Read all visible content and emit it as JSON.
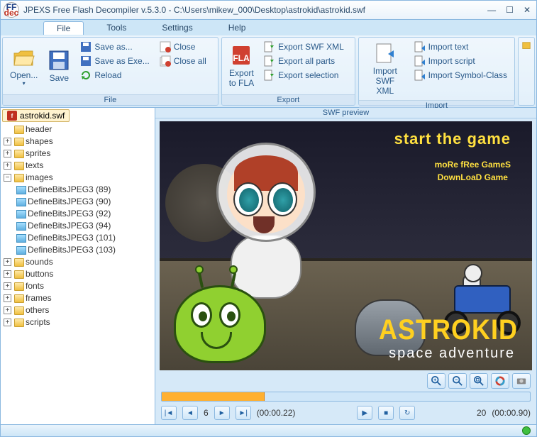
{
  "window": {
    "title": "JPEXS Free Flash Decompiler v.5.3.0 - C:\\Users\\mikew_000\\Desktop\\astrokid\\astrokid.swf",
    "logo_top": "FF",
    "logo_bottom": "dec"
  },
  "menu": {
    "file": "File",
    "tools": "Tools",
    "settings": "Settings",
    "help": "Help"
  },
  "ribbon": {
    "file_group": {
      "label": "File",
      "open": "Open...",
      "save": "Save",
      "save_as": "Save as...",
      "save_as_exe": "Save as Exe...",
      "reload": "Reload",
      "close": "Close",
      "close_all": "Close all"
    },
    "export_group": {
      "label": "Export",
      "export_fla": "Export\nto FLA",
      "export_swf_xml": "Export SWF XML",
      "export_all_parts": "Export all parts",
      "export_selection": "Export selection"
    },
    "import_group": {
      "label": "Import",
      "import_swf_xml": "Import\nSWF XML",
      "import_text": "Import text",
      "import_script": "Import script",
      "import_symbol_class": "Import Symbol-Class"
    }
  },
  "tree": {
    "root": "astrokid.swf",
    "header": "header",
    "shapes": "shapes",
    "sprites": "sprites",
    "texts": "texts",
    "images": "images",
    "images_children": [
      "DefineBitsJPEG3 (89)",
      "DefineBitsJPEG3 (90)",
      "DefineBitsJPEG3 (92)",
      "DefineBitsJPEG3 (94)",
      "DefineBitsJPEG3 (101)",
      "DefineBitsJPEG3 (103)"
    ],
    "sounds": "sounds",
    "buttons": "buttons",
    "fonts": "fonts",
    "frames": "frames",
    "others": "others",
    "scripts": "scripts"
  },
  "preview": {
    "header": "SWF preview",
    "start_game": "StaRt tHe Game",
    "more_games": "moRe fRee GameS",
    "download_game": "DownLoaD Game",
    "title_logo": "ASTROKID",
    "subtitle": "space adventure"
  },
  "playback": {
    "current_frame": "6",
    "current_time": "(00:00.22)",
    "total_frames": "20",
    "total_time": "(00:00.90)",
    "progress_pct": 28
  }
}
